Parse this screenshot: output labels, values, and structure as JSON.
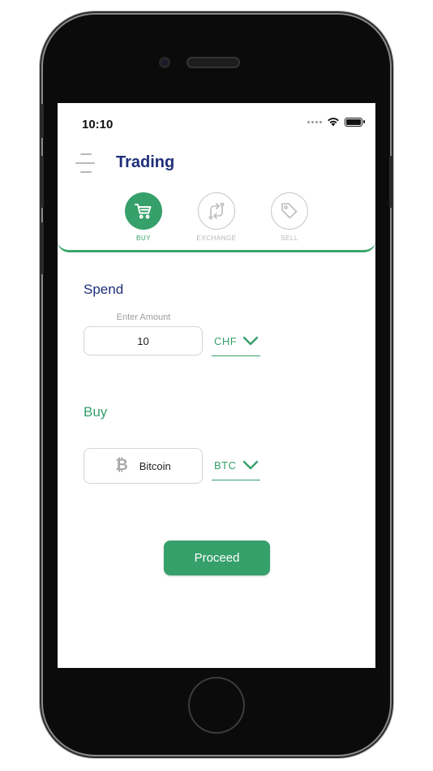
{
  "status_bar": {
    "time": "10:10"
  },
  "header": {
    "title": "Trading"
  },
  "tabs": [
    {
      "label": "BUY",
      "icon": "cart-icon",
      "active": true
    },
    {
      "label": "EXCHANGE",
      "icon": "exchange-icon",
      "active": false
    },
    {
      "label": "SELL",
      "icon": "tag-icon",
      "active": false
    }
  ],
  "spend": {
    "title": "Spend",
    "amount_label": "Enter Amount",
    "amount_value": "10",
    "currency": "CHF"
  },
  "buy": {
    "title": "Buy",
    "coin_name": "Bitcoin",
    "coin_icon": "bitcoin-icon",
    "currency": "BTC"
  },
  "proceed_label": "Proceed",
  "colors": {
    "accent_green": "#36a06a",
    "title_navy": "#1f2f7a"
  }
}
